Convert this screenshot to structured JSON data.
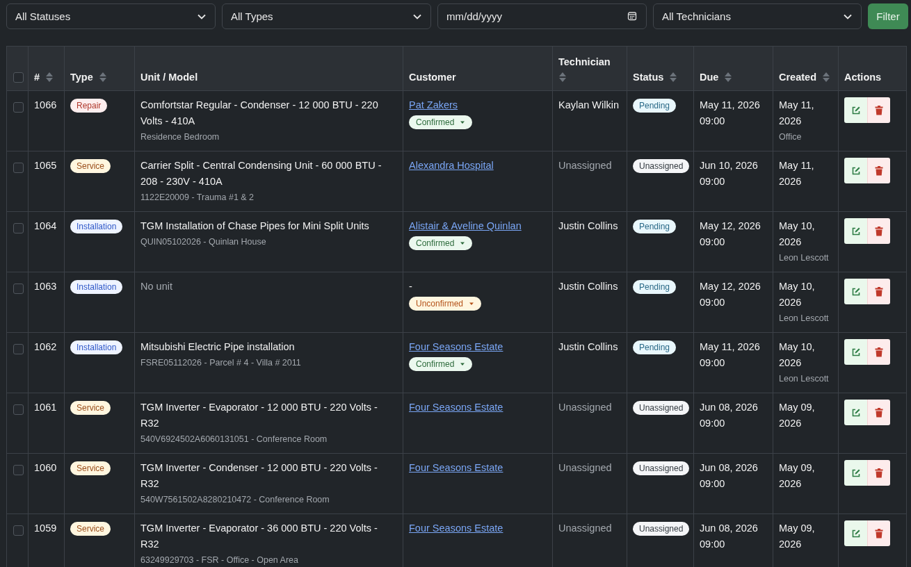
{
  "filters": [
    {
      "kind": "select",
      "value": "All Statuses"
    },
    {
      "kind": "select",
      "value": "All Types"
    },
    {
      "kind": "date",
      "placeholder": "mm/dd/yyyy"
    },
    {
      "kind": "select",
      "value": "All Technicians"
    }
  ],
  "filter_button": "Filter",
  "table": {
    "select_all": {
      "checked": false
    },
    "columns": [
      {
        "label": "#",
        "sortable": true
      },
      {
        "label": "Type",
        "sortable": true
      },
      {
        "label": "Unit / Model",
        "sortable": false
      },
      {
        "label": "Customer",
        "sortable": false
      },
      {
        "label": "Technician",
        "sortable": true
      },
      {
        "label": "Status",
        "sortable": true
      },
      {
        "label": "Due",
        "sortable": true
      },
      {
        "label": "Created",
        "sortable": true
      },
      {
        "label": "Actions",
        "sortable": false
      }
    ],
    "rows": [
      {
        "checked": false,
        "id": "1066",
        "type": {
          "label": "Repair",
          "kind": "repair"
        },
        "unit": {
          "title": "Comfortstar Regular - Condenser - 12 000 BTU - 220 Volts - 410A",
          "muted": false,
          "subtitle": "Residence Bedroom"
        },
        "customer": {
          "name": "Pat Zakers",
          "linked": true,
          "confirmation": {
            "label": "Confirmed",
            "kind": "confirmed"
          }
        },
        "technician": {
          "name": "Kaylan Wilkin",
          "assigned": true
        },
        "status": {
          "label": "Pending",
          "kind": "pending"
        },
        "due": [
          "May 11, 2026",
          "09:00"
        ],
        "created": {
          "date": "May 11, 2026",
          "by": "Office"
        }
      },
      {
        "checked": false,
        "id": "1065",
        "type": {
          "label": "Service",
          "kind": "service"
        },
        "unit": {
          "title": "Carrier Split - Central Condensing Unit - 60 000 BTU - 208 - 230V - 410A",
          "muted": false,
          "subtitle": "1122E20009 - Trauma #1 & 2"
        },
        "customer": {
          "name": "Alexandra Hospital",
          "linked": true
        },
        "technician": {
          "name": "Unassigned",
          "assigned": false
        },
        "status": {
          "label": "Unassigned",
          "kind": "unassigned"
        },
        "due": [
          "Jun 10, 2026",
          "09:00"
        ],
        "created": {
          "date": "May 11, 2026"
        }
      },
      {
        "checked": false,
        "id": "1064",
        "type": {
          "label": "Installation",
          "kind": "installation"
        },
        "unit": {
          "title": "TGM Installation of Chase Pipes for Mini Split Units",
          "muted": false,
          "subtitle": "QUIN05102026 - Quinlan House"
        },
        "customer": {
          "name": "Alistair & Aveline Quinlan",
          "linked": true,
          "confirmation": {
            "label": "Confirmed",
            "kind": "confirmed"
          }
        },
        "technician": {
          "name": "Justin Collins",
          "assigned": true
        },
        "status": {
          "label": "Pending",
          "kind": "pending"
        },
        "due": [
          "May 12, 2026",
          "09:00"
        ],
        "created": {
          "date": "May 10, 2026",
          "by": "Leon Lescott"
        }
      },
      {
        "checked": false,
        "id": "1063",
        "type": {
          "label": "Installation",
          "kind": "installation"
        },
        "unit": {
          "title": "No unit",
          "muted": true
        },
        "customer": {
          "name": "-",
          "linked": false,
          "confirmation": {
            "label": "Unconfirmed",
            "kind": "unconfirmed"
          }
        },
        "technician": {
          "name": "Justin Collins",
          "assigned": true
        },
        "status": {
          "label": "Pending",
          "kind": "pending"
        },
        "due": [
          "May 12, 2026",
          "09:00"
        ],
        "created": {
          "date": "May 10, 2026",
          "by": "Leon Lescott"
        }
      },
      {
        "checked": false,
        "id": "1062",
        "type": {
          "label": "Installation",
          "kind": "installation"
        },
        "unit": {
          "title": "Mitsubishi Electric Pipe installation",
          "muted": false,
          "subtitle": "FSRE05112026 - Parcel # 4 - Villa # 2011"
        },
        "customer": {
          "name": "Four Seasons Estate",
          "linked": true,
          "confirmation": {
            "label": "Confirmed",
            "kind": "confirmed"
          }
        },
        "technician": {
          "name": "Justin Collins",
          "assigned": true
        },
        "status": {
          "label": "Pending",
          "kind": "pending"
        },
        "due": [
          "May 11, 2026",
          "09:00"
        ],
        "created": {
          "date": "May 10, 2026",
          "by": "Leon Lescott"
        }
      },
      {
        "checked": false,
        "id": "1061",
        "type": {
          "label": "Service",
          "kind": "service"
        },
        "unit": {
          "title": "TGM Inverter - Evaporator - 12 000 BTU - 220 Volts - R32",
          "muted": false,
          "subtitle": "540V6924502A6060131051 - Conference Room"
        },
        "customer": {
          "name": "Four Seasons Estate",
          "linked": true
        },
        "technician": {
          "name": "Unassigned",
          "assigned": false
        },
        "status": {
          "label": "Unassigned",
          "kind": "unassigned"
        },
        "due": [
          "Jun 08, 2026",
          "09:00"
        ],
        "created": {
          "date": "May 09, 2026"
        }
      },
      {
        "checked": false,
        "id": "1060",
        "type": {
          "label": "Service",
          "kind": "service"
        },
        "unit": {
          "title": "TGM Inverter - Condenser - 12 000 BTU - 220 Volts - R32",
          "muted": false,
          "subtitle": "540W7561502A8280210472 - Conference Room"
        },
        "customer": {
          "name": "Four Seasons Estate",
          "linked": true
        },
        "technician": {
          "name": "Unassigned",
          "assigned": false
        },
        "status": {
          "label": "Unassigned",
          "kind": "unassigned"
        },
        "due": [
          "Jun 08, 2026",
          "09:00"
        ],
        "created": {
          "date": "May 09, 2026"
        }
      },
      {
        "checked": false,
        "id": "1059",
        "type": {
          "label": "Service",
          "kind": "service"
        },
        "unit": {
          "title": "TGM Inverter - Evaporator - 36 000 BTU - 220 Volts - R32",
          "muted": false,
          "subtitle": "63249929703 - FSR - Office - Open Area"
        },
        "customer": {
          "name": "Four Seasons Estate",
          "linked": true
        },
        "technician": {
          "name": "Unassigned",
          "assigned": false
        },
        "status": {
          "label": "Unassigned",
          "kind": "unassigned"
        },
        "due": [
          "Jun 08, 2026",
          "09:00"
        ],
        "created": {
          "date": "May 09, 2026"
        }
      }
    ]
  }
}
